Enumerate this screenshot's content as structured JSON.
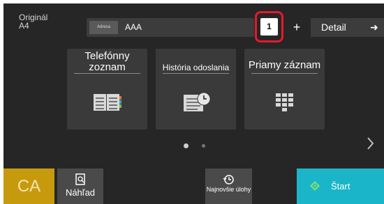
{
  "header": {
    "original_label": "Originál",
    "original_size": "A4",
    "address_tag": "Adresa",
    "address_value": "AAA",
    "count": "1",
    "plus_label": "+",
    "detail_label": "Detail",
    "detail_arrow": "➜"
  },
  "shortcuts": [
    {
      "label": "Telefónny zoznam",
      "icon": "address-book-icon"
    },
    {
      "label": "História odoslania",
      "icon": "send-history-icon"
    },
    {
      "label": "Priamy záznam",
      "icon": "keypad-icon"
    }
  ],
  "pager": {
    "pages": 2,
    "current": 1
  },
  "bottom": {
    "ca_label": "CA",
    "preview_label": "Náhľad",
    "recent_label": "Najnovšie úlohy",
    "start_label": "Štart"
  },
  "colors": {
    "background": "#262626",
    "card": "#3a3a3a",
    "highlight": "#e8182c",
    "ca": "#c79a0e",
    "start": "#1ab5c8"
  }
}
